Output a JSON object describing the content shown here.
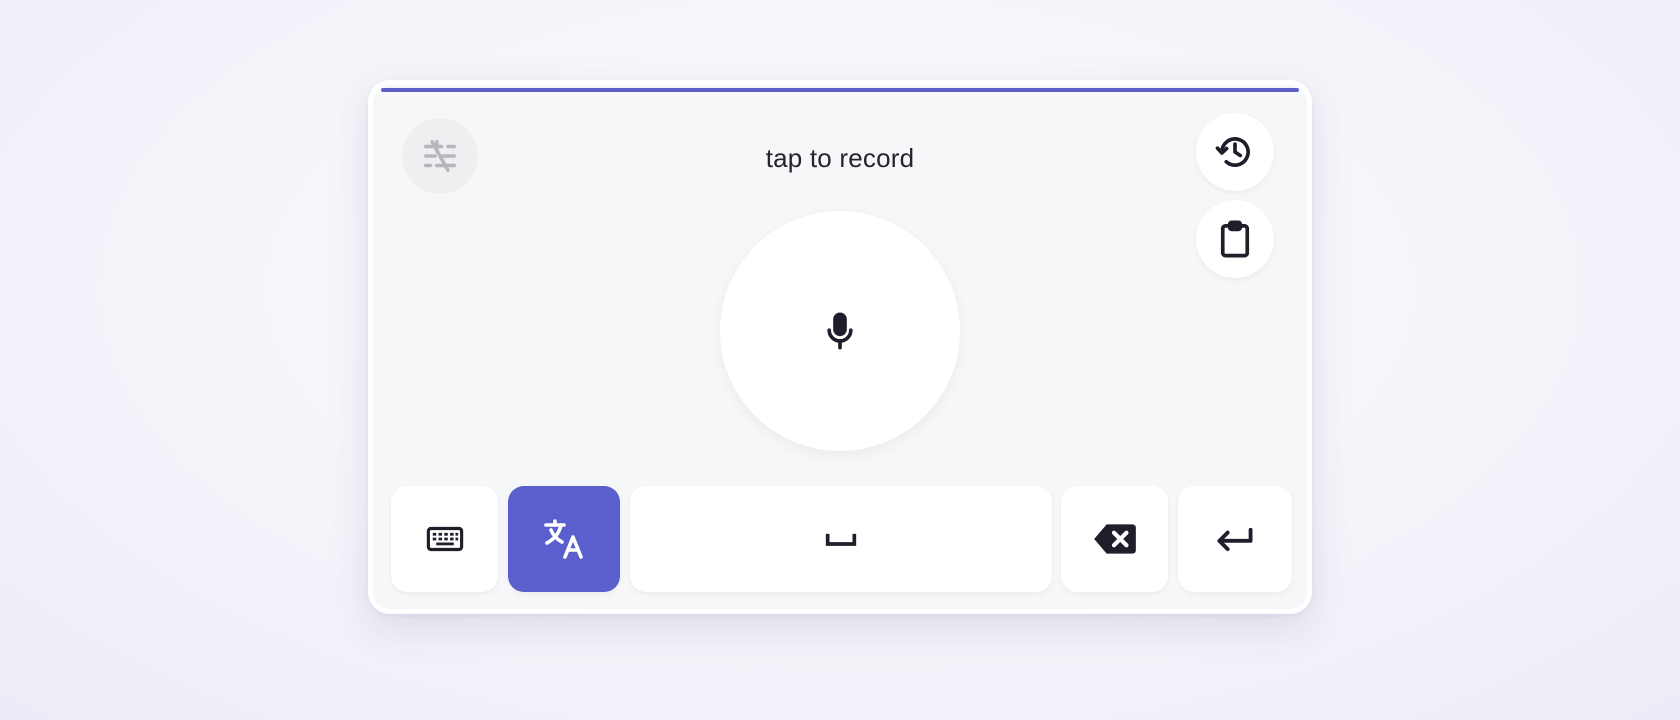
{
  "status": {
    "text": "tap to record"
  },
  "colors": {
    "accent": "#5b5fc7",
    "translate_key_bg": "#5b5fcd",
    "panel_bg": "#f6f7f9",
    "icon_dark": "#1f1f2b",
    "icon_disabled": "#b6b6bb"
  },
  "icons": {
    "top_left": "clear-format-icon",
    "top_right_1": "history-icon",
    "top_right_2": "clipboard-icon",
    "center": "microphone-icon",
    "keys": [
      "keyboard-icon",
      "translate-icon",
      "space-bar-icon",
      "backspace-icon",
      "enter-icon"
    ]
  }
}
